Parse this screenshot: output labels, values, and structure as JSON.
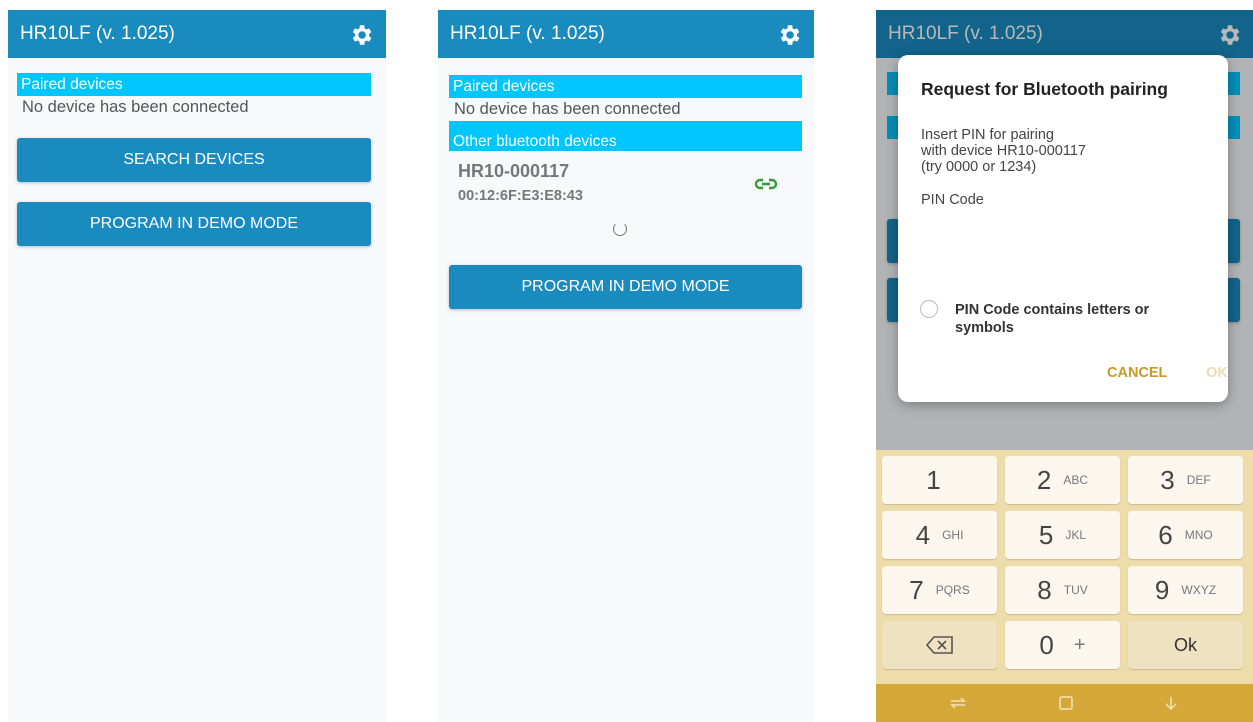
{
  "app_title": "HR10LF (v. 1.025)",
  "icons": {
    "settings": "gear-icon",
    "link": "link-icon",
    "backspace": "backspace-icon",
    "spinner": "loading-spinner",
    "nav_recents": "recents-icon",
    "nav_home": "home-icon",
    "nav_back": "back-icon"
  },
  "colors": {
    "app_bar": "#1a8bbf",
    "section_header": "#00c6ff",
    "button": "#1a8bbf",
    "keypad": "#eedcab",
    "dialog_action": "#c69a29"
  },
  "screen1": {
    "paired_header": "Paired devices",
    "no_device": "No device has been connected",
    "search_button": "SEARCH DEVICES",
    "demo_button": "PROGRAM IN DEMO MODE"
  },
  "screen2": {
    "paired_header": "Paired devices",
    "no_device": "No device has been connected",
    "other_header": "Other bluetooth devices",
    "device_name": "HR10-000117",
    "device_mac": "00:12:6F:E3:E8:43",
    "demo_button": "PROGRAM IN DEMO MODE"
  },
  "screen3": {
    "dialog": {
      "title": "Request for Bluetooth pairing",
      "message": "Insert PIN for pairing\nwith device HR10-000117\n(try 0000 or 1234)",
      "pin_label": "PIN Code",
      "checkbox_label": "PIN Code contains letters or symbols",
      "cancel": "CANCEL",
      "ok": "OK"
    },
    "keypad": [
      {
        "digit": "1",
        "letters": ""
      },
      {
        "digit": "2",
        "letters": "ABC"
      },
      {
        "digit": "3",
        "letters": "DEF"
      },
      {
        "digit": "4",
        "letters": "GHI"
      },
      {
        "digit": "5",
        "letters": "JKL"
      },
      {
        "digit": "6",
        "letters": "MNO"
      },
      {
        "digit": "7",
        "letters": "PQRS"
      },
      {
        "digit": "8",
        "letters": "TUV"
      },
      {
        "digit": "9",
        "letters": "WXYZ"
      }
    ],
    "zero": "0",
    "plus": "+",
    "ok_key": "Ok"
  }
}
